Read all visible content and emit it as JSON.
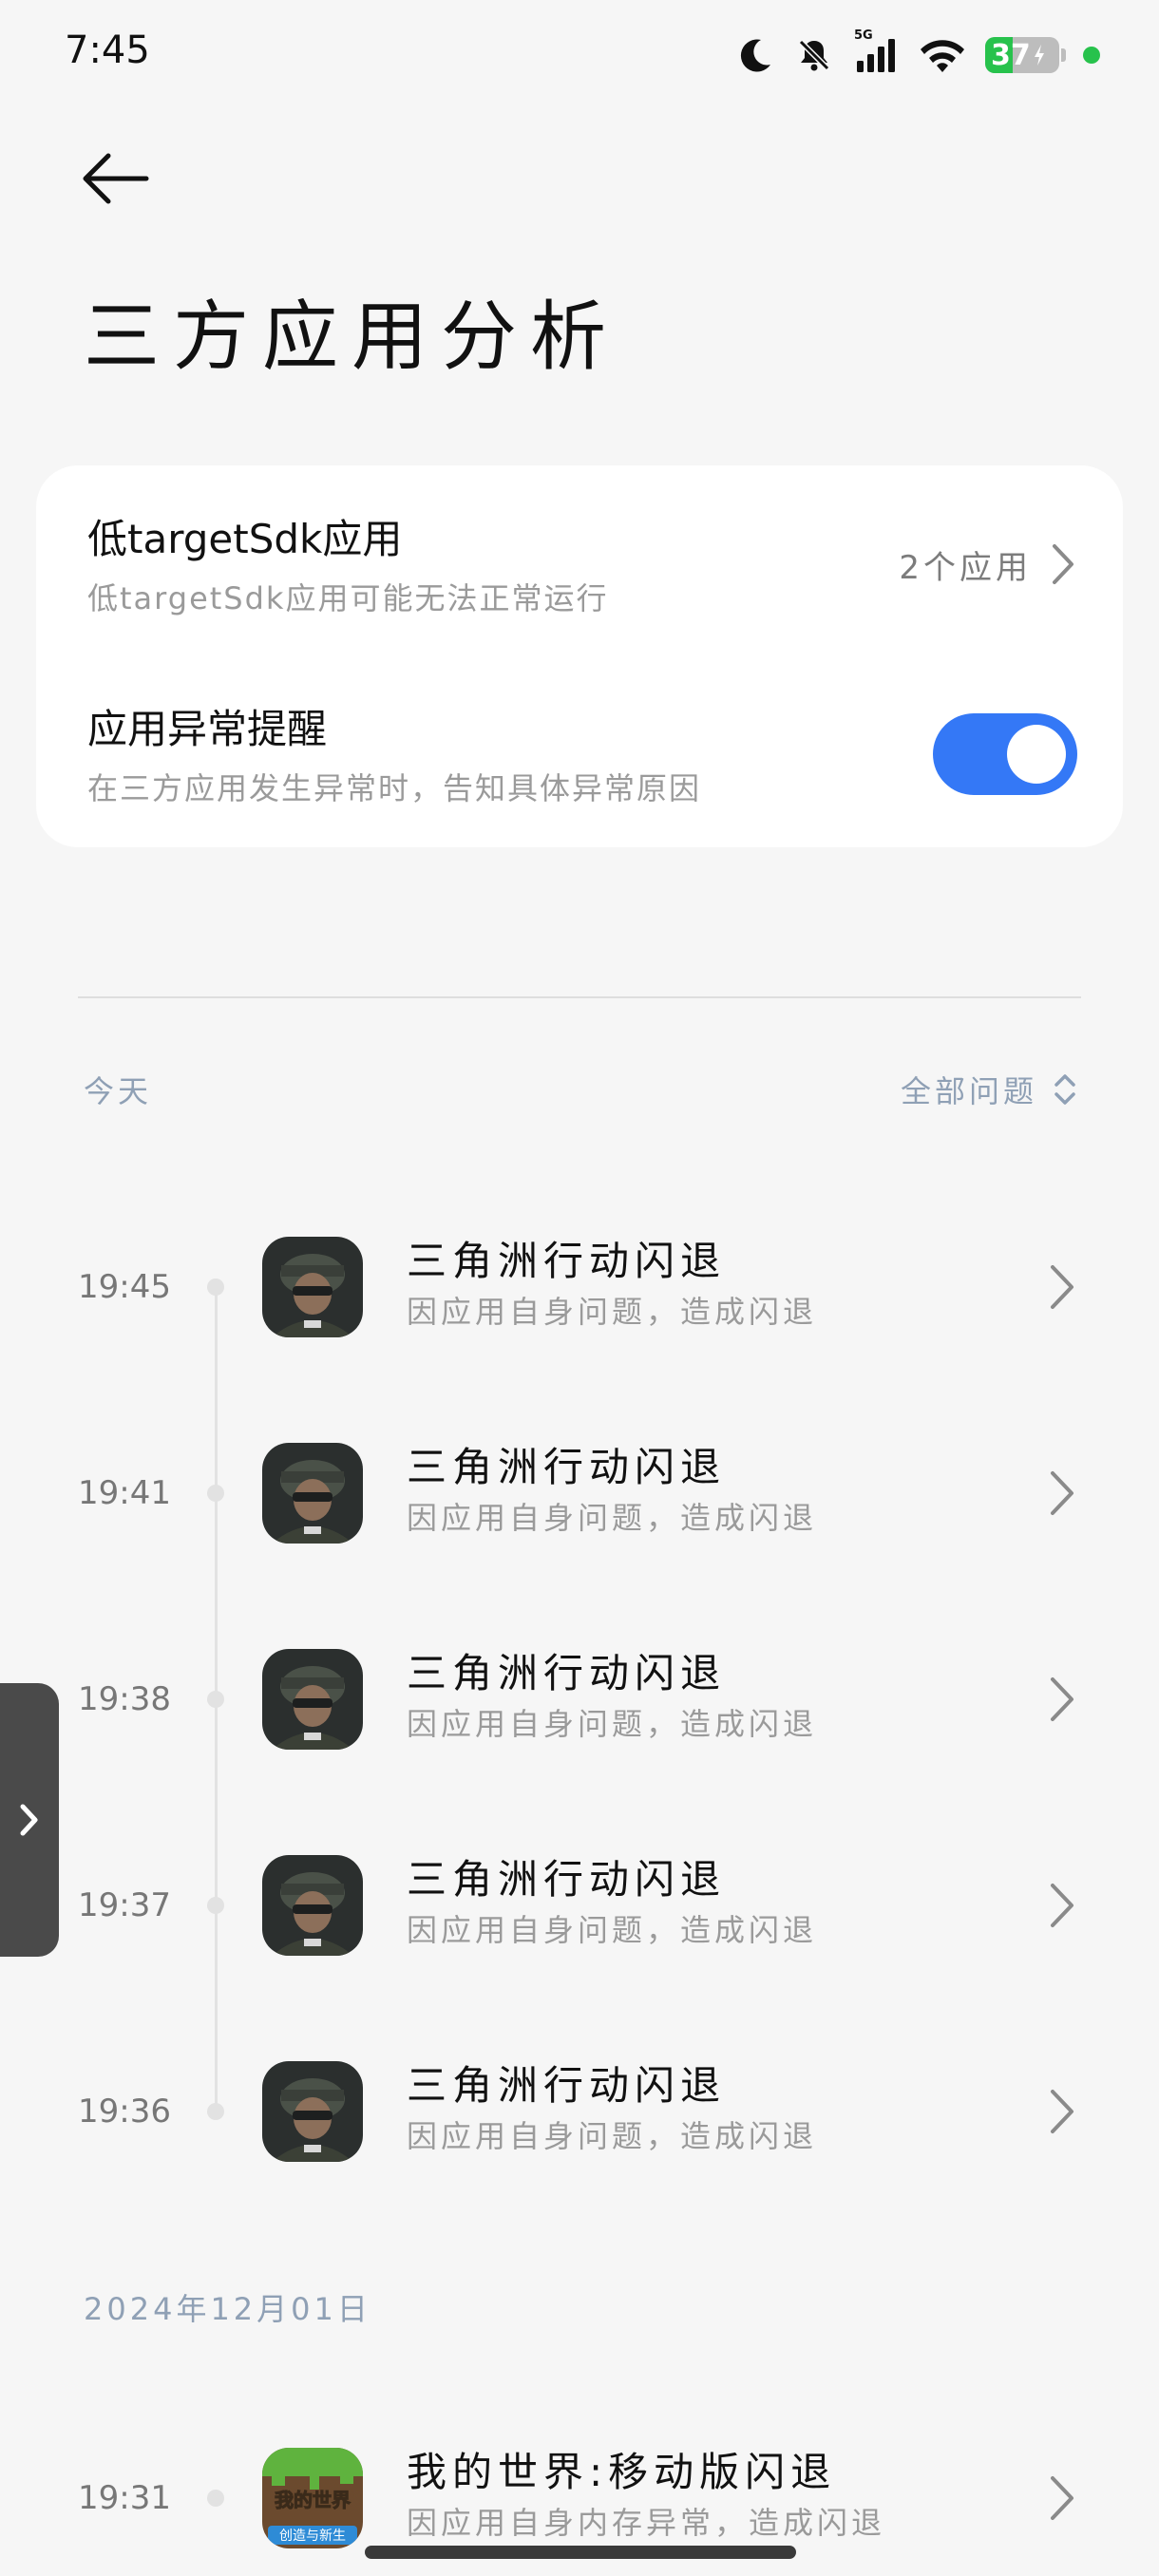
{
  "status_bar": {
    "time": "7:45",
    "battery": "37",
    "battery_level": 0.37,
    "network": "5G",
    "icons": [
      "moon-icon",
      "bell-off-icon",
      "signal-icon",
      "wifi-icon",
      "battery-icon"
    ]
  },
  "header": {
    "back_icon": "arrow-left-icon",
    "title": "三方应用分析"
  },
  "settings": {
    "low_target_sdk": {
      "title": "低targetSdk应用",
      "subtitle": "低targetSdk应用可能无法正常运行",
      "value": "2个应用"
    },
    "app_exception_alert": {
      "title": "应用异常提醒",
      "subtitle": "在三方应用发生异常时，告知具体异常原因",
      "enabled": true
    }
  },
  "colors": {
    "accent": "#3478f6",
    "background": "#f6f6f6",
    "section_label": "#8fa0b5",
    "battery_green": "#27c24c"
  },
  "today_section": {
    "label": "今天",
    "filter_label": "全部问题",
    "items": [
      {
        "time": "19:45",
        "title": "三角洲行动闪退",
        "subtitle": "因应用自身问题，造成闪退",
        "icon": "delta-force-app-icon"
      },
      {
        "time": "19:41",
        "title": "三角洲行动闪退",
        "subtitle": "因应用自身问题，造成闪退",
        "icon": "delta-force-app-icon"
      },
      {
        "time": "19:38",
        "title": "三角洲行动闪退",
        "subtitle": "因应用自身问题，造成闪退",
        "icon": "delta-force-app-icon"
      },
      {
        "time": "19:37",
        "title": "三角洲行动闪退",
        "subtitle": "因应用自身问题，造成闪退",
        "icon": "delta-force-app-icon"
      },
      {
        "time": "19:36",
        "title": "三角洲行动闪退",
        "subtitle": "因应用自身问题，造成闪退",
        "icon": "delta-force-app-icon"
      }
    ]
  },
  "dec_section": {
    "label": "2024年12月01日",
    "items": [
      {
        "time": "19:31",
        "title": "我的世界:移动版闪退",
        "subtitle": "因应用自身内存异常，造成闪退",
        "icon": "minecraft-app-icon",
        "icon_text_top": "我的世界",
        "icon_text_bottom": "创造与新生"
      }
    ]
  }
}
